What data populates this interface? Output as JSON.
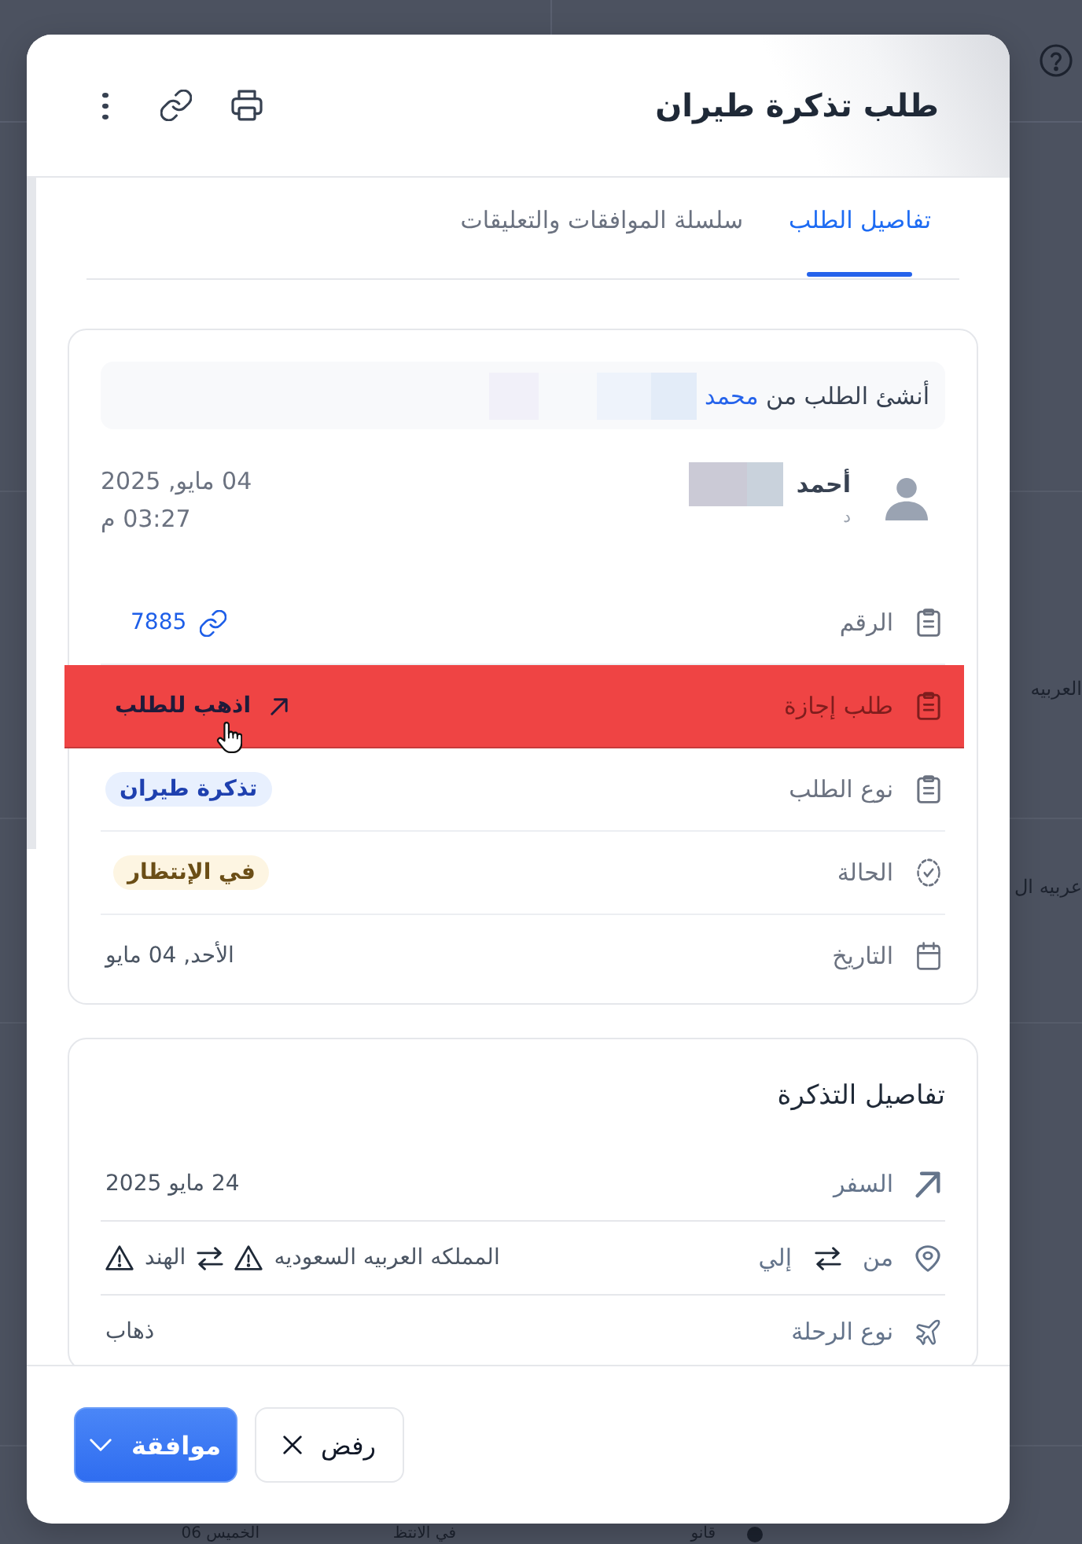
{
  "backdrop": {
    "edge_texts": [
      "العربيه",
      "عربيه ال"
    ],
    "bottom_texts": [
      "قانو",
      "في الانتظ",
      "الخميس 06"
    ]
  },
  "modal": {
    "title": "طلب تذكرة طيران",
    "tabs": [
      {
        "label": "تفاصيل الطلب",
        "selected": true
      },
      {
        "label": "سلسلة الموافقات والتعليقات",
        "selected": false
      }
    ],
    "request_card": {
      "creator": {
        "prefix": "أنشئ الطلب من",
        "name": "محمد"
      },
      "requester": {
        "name": "أحمد",
        "subtitle": "د",
        "date": "04 مايو, 2025",
        "time": "03:27 م"
      },
      "fields": [
        {
          "kind": "link",
          "label": "الرقم",
          "value": "7885",
          "highlighted": false
        },
        {
          "kind": "goto",
          "label": "طلب إجازة",
          "value": "اذهب للطلب",
          "highlighted": true
        },
        {
          "kind": "type_badge",
          "label": "نوع الطلب",
          "value": "تذكرة طيران",
          "highlighted": false
        },
        {
          "kind": "status_badge",
          "label": "الحالة",
          "value": "في الإنتظار",
          "highlighted": false
        },
        {
          "kind": "text",
          "label": "التاريخ",
          "value": "الأحد, 04 مايو",
          "highlighted": false
        }
      ]
    },
    "ticket_card": {
      "title": "تفاصيل التذكرة",
      "fields": [
        {
          "kind": "text",
          "label": "السفر",
          "value": "24 مايو 2025"
        },
        {
          "kind": "route",
          "label": "من",
          "label_to": "إلي",
          "from": "المملكه العربيه السعوديه",
          "to": "الهند",
          "from_warning": true,
          "to_warning": true
        },
        {
          "kind": "text",
          "label": "نوع الرحلة",
          "value": "ذهاب"
        }
      ]
    },
    "buttons": [
      {
        "kind": "secondary",
        "label": "رفض"
      },
      {
        "kind": "primary",
        "label": "موافقة"
      }
    ]
  }
}
